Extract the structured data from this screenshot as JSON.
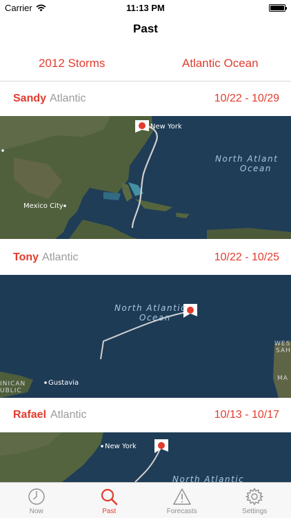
{
  "status_bar": {
    "carrier": "Carrier",
    "time": "11:13 PM"
  },
  "nav": {
    "title": "Past"
  },
  "filters": {
    "year": "2012 Storms",
    "basin": "Atlantic Ocean"
  },
  "storms": [
    {
      "name": "Sandy",
      "basin": "Atlantic",
      "dates": "10/22 - 10/29",
      "map_labels": {
        "city1": "New York",
        "city2": "Mexico City",
        "ocean_line1": "North Atlant",
        "ocean_line2": "Ocean"
      }
    },
    {
      "name": "Tony",
      "basin": "Atlantic",
      "dates": "10/22 - 10/25",
      "map_labels": {
        "ocean_line1": "North Atlantic",
        "ocean_line2": "Ocean",
        "city1": "Gustavia",
        "edge1": "INICAN",
        "edge2": "UBLIC",
        "edge3": "WES",
        "edge4": "SAH",
        "edge5": "MA"
      }
    },
    {
      "name": "Rafael",
      "basin": "Atlantic",
      "dates": "10/13 - 10/17",
      "map_labels": {
        "city1": "New York",
        "ocean_line1": "North Atlantic"
      }
    }
  ],
  "tabs": [
    {
      "label": "Now",
      "icon": "clock-icon",
      "active": false
    },
    {
      "label": "Past",
      "icon": "search-icon",
      "active": true
    },
    {
      "label": "Forecasts",
      "icon": "warning-icon",
      "active": false
    },
    {
      "label": "Settings",
      "icon": "gear-icon",
      "active": false
    }
  ],
  "colors": {
    "accent": "#e23b2e",
    "secondary_text": "#9a9a9a",
    "ocean": "#1e3c55",
    "land": "#4b5a3a"
  }
}
